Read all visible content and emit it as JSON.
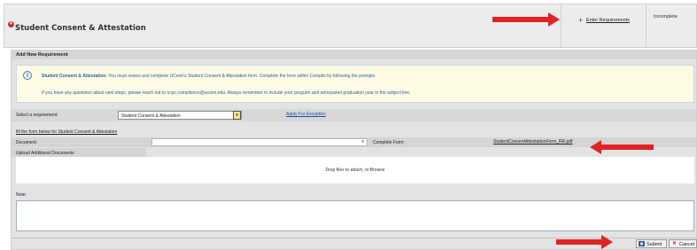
{
  "header": {
    "title": "Student Consent & Attestation",
    "enter_requirements": "Enter Requirements",
    "status": "Incomplete"
  },
  "panel": {
    "heading": "Add New Requirement",
    "info": {
      "bold_lead": "Student Consent & Attestation:",
      "line1_rest": " You must review and complete UConn's Student Consent & Attestation form. Complete the form within Complio by following the prompts.",
      "line2": "If you have any questions about next steps, please reach out to ocpc.compliance@uconn.edu. Always remember to include your program and anticipated graduation year in the subject line."
    },
    "select_label": "Select a requirement:",
    "select_value": "Student Consent & Attestation",
    "apply_exception": "Apply For Exception",
    "fill_form_link": "fill the form below for Student Consent & Attestation",
    "document_label": "Document:",
    "complete_form_label": "Complete Form:",
    "form_file": "StudentConsentAttestationForm_RR.pdf",
    "upload_label": "Upload Additional Documents",
    "drop_text": "Drop files to attach, or Browse",
    "note_label": "Note:",
    "submit_label": "Submit",
    "cancel_label": "Cancel"
  },
  "icons": {
    "error": "error-circle-icon",
    "plus": "plus-icon",
    "info": "info-icon",
    "dropdown": "chevron-down-icon",
    "save": "save-icon",
    "cancel": "close-icon"
  },
  "colors": {
    "arrow": "#e02424",
    "link": "#1f4fa8",
    "info_text": "#2e5f9c",
    "info_bg": "#fdfbe3"
  }
}
